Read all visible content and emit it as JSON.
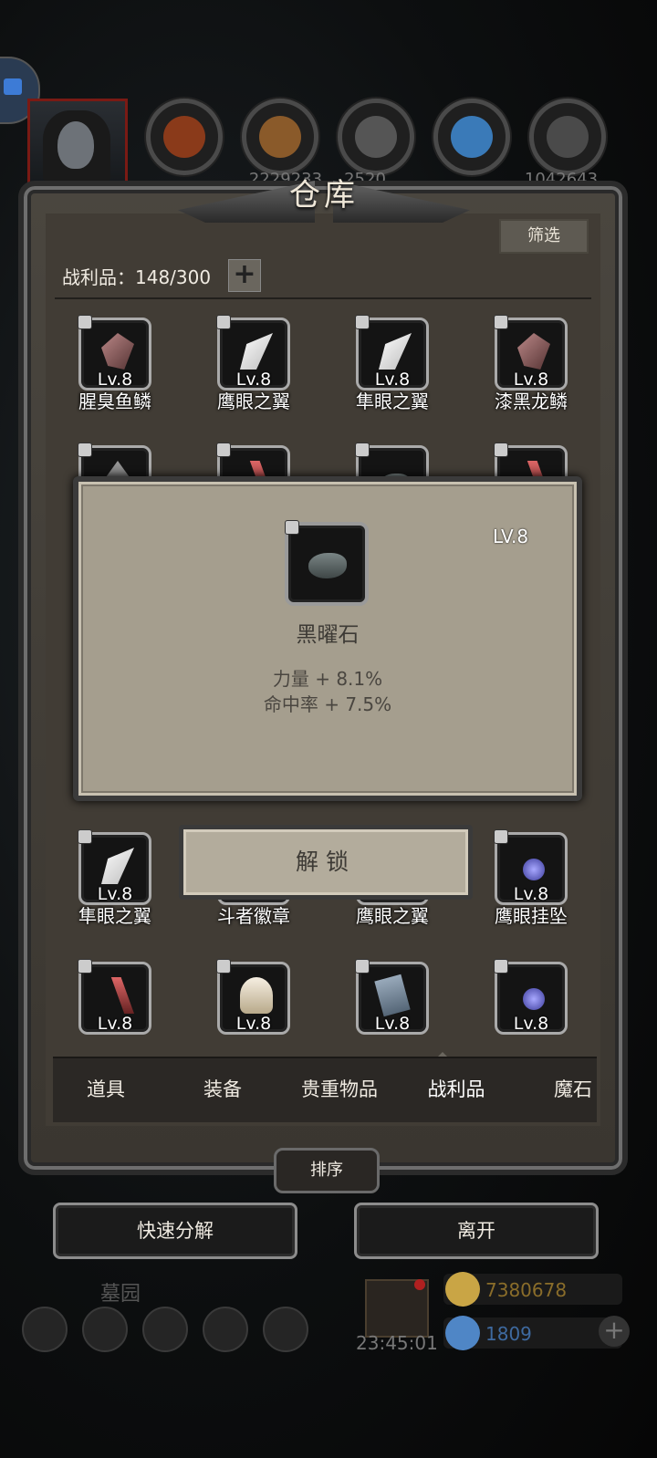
{
  "header": {
    "resources": [
      {
        "icon": "meat-icon",
        "value": "",
        "color": "#8a3a1a"
      },
      {
        "icon": "wood-icon",
        "value": "2229233",
        "color": "#8a5a2a"
      },
      {
        "icon": "stone-icon",
        "value": "2520",
        "color": "#555555"
      },
      {
        "icon": "crystal-icon",
        "value": "",
        "color": "#3a7ab8"
      },
      {
        "icon": "iron-icon",
        "value": "1042643",
        "color": "#4a4a4a"
      }
    ]
  },
  "warehouse": {
    "title": "仓库",
    "filter_label": "筛选",
    "count_label": "战利品：148/300",
    "plus_label": "+",
    "items": [
      {
        "name": "腥臭鱼鳞",
        "level": "Lv.8",
        "art": "scale"
      },
      {
        "name": "鹰眼之翼",
        "level": "Lv.8",
        "art": "wing"
      },
      {
        "name": "隼眼之翼",
        "level": "Lv.8",
        "art": "wing"
      },
      {
        "name": "漆黑龙鳞",
        "level": "Lv.8",
        "art": "scale"
      },
      {
        "name": "",
        "level": "",
        "art": "misc"
      },
      {
        "name": "",
        "level": "",
        "art": "claw"
      },
      {
        "name": "",
        "level": "",
        "art": "stone"
      },
      {
        "name": "",
        "level": "",
        "art": "claw"
      },
      {
        "name": "隼眼之翼",
        "level": "Lv.8",
        "art": "wing"
      },
      {
        "name": "斗者徽章",
        "level": "",
        "art": "misc"
      },
      {
        "name": "鹰眼之翼",
        "level": "",
        "art": "wing"
      },
      {
        "name": "鹰眼挂坠",
        "level": "Lv.8",
        "art": "pendant"
      },
      {
        "name": "",
        "level": "Lv.8",
        "art": "claw"
      },
      {
        "name": "",
        "level": "Lv.8",
        "art": "fur"
      },
      {
        "name": "",
        "level": "Lv.8",
        "art": "book"
      },
      {
        "name": "",
        "level": "Lv.8",
        "art": "pendant"
      }
    ],
    "tabs": [
      "道具",
      "装备",
      "贵重物品",
      "战利品",
      "魔石"
    ],
    "active_tab": "战利品",
    "sort_label": "排序"
  },
  "actions": {
    "quick_decompose": "快速分解",
    "leave": "离开"
  },
  "popup": {
    "level": "LV.8",
    "name": "黑曜石",
    "stats": [
      "力量 + 8.1%",
      "命中率 + 7.5%"
    ],
    "unlock_label": "解锁"
  },
  "hud": {
    "location": "墓园",
    "timer": "23:45:01",
    "gold": "7380678",
    "gems": "1809",
    "gold_color": "#c9a545",
    "gem_color": "#4f86c6"
  }
}
